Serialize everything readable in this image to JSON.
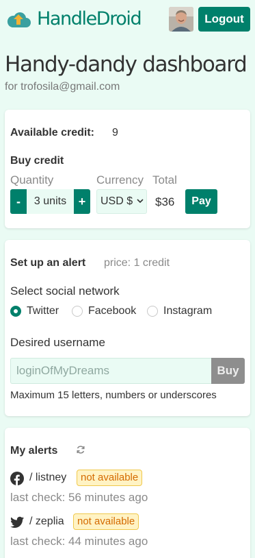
{
  "header": {
    "brand": "HandleDroid",
    "logout_label": "Logout"
  },
  "page": {
    "title": "Handy-dandy dashboard",
    "subtitle": "for trofosila@gmail.com"
  },
  "credit": {
    "available_label": "Available credit:",
    "available_value": "9",
    "buy_title": "Buy credit",
    "quantity_label": "Quantity",
    "currency_label": "Currency",
    "total_label": "Total",
    "minus_label": "-",
    "plus_label": "+",
    "quantity_value": "3 units",
    "currency_value": "USD $",
    "total_value": "$36",
    "pay_label": "Pay"
  },
  "alert_setup": {
    "title": "Set up an alert",
    "price": "price: 1 credit",
    "network_label": "Select social network",
    "networks": [
      {
        "label": "Twitter",
        "checked": true
      },
      {
        "label": "Facebook",
        "checked": false
      },
      {
        "label": "Instagram",
        "checked": false
      }
    ],
    "username_label": "Desired username",
    "username_placeholder": "loginOfMyDreams",
    "buy_label": "Buy",
    "hint": "Maximum 15 letters, numbers or underscores"
  },
  "my_alerts": {
    "title": "My alerts",
    "items": [
      {
        "icon": "facebook-icon",
        "handle": "/ listney",
        "status": "not available",
        "last_check": "last check: 56 minutes ago"
      },
      {
        "icon": "twitter-icon",
        "handle": "/ zeplia",
        "status": "not available",
        "last_check": "last check: 44 minutes ago"
      }
    ]
  },
  "colors": {
    "brand": "#00806b",
    "background": "#eafbf4",
    "badge_bg": "#fff3c4",
    "badge_text": "#d46a00"
  }
}
